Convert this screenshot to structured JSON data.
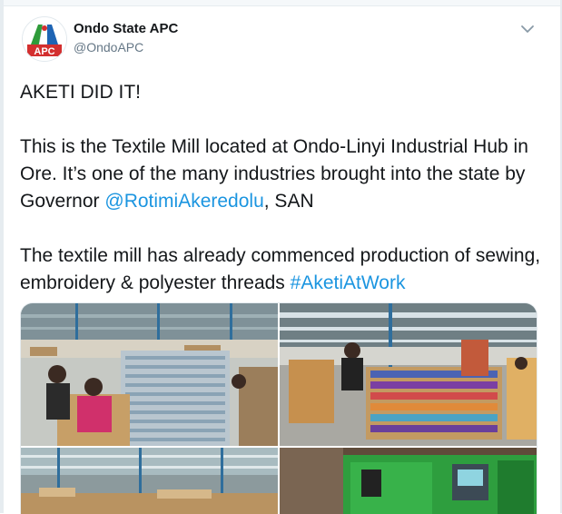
{
  "account": {
    "name": "Ondo State APC",
    "handle": "@OndoAPC",
    "avatar_text": "APC",
    "avatar_colors": [
      "#2e9b3a",
      "#d32f2f",
      "#1e64b4"
    ]
  },
  "tweet": {
    "line1": "AKETI DID IT!",
    "para2_before": "This is the Textile Mill located at Ondo-Linyi Industrial Hub in Ore. It’s one of the many industries brought into the state by Governor ",
    "mention": "@RotimiAkeredolu",
    "para2_after": ", SAN",
    "para3_before": "The textile mill has already commenced production of sewing, embroidery & polyester threads ",
    "hashtag": "#AketiAtWork"
  },
  "icons": {
    "menu": "chevron-down-icon"
  },
  "colors": {
    "link": "#1b95e0",
    "text": "#14171a",
    "secondary": "#657786"
  }
}
